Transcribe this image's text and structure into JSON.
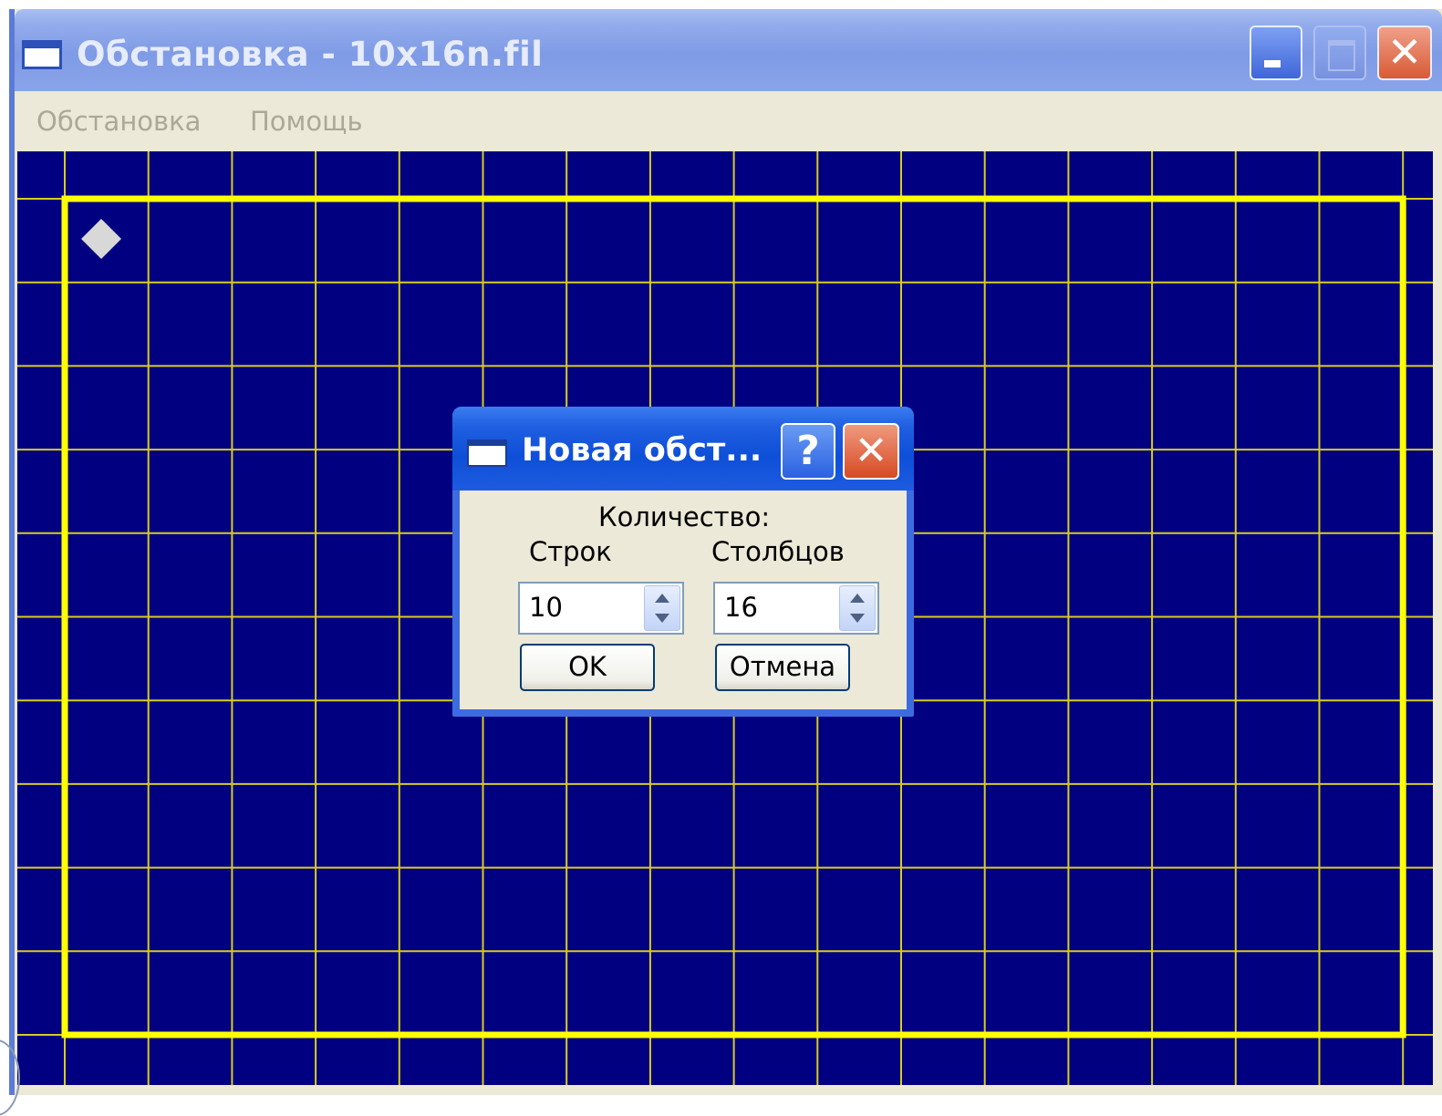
{
  "window": {
    "title": "Обстановка - 10x16n.fil",
    "icon": "window-app-icon",
    "buttons": {
      "minimize": "minimize-icon",
      "maximize": "maximize-icon",
      "close": "✕"
    }
  },
  "menu": {
    "items": [
      {
        "label": "Обстановка"
      },
      {
        "label": "Помощь"
      }
    ]
  },
  "field": {
    "rows": 10,
    "cols": 16,
    "background_color": "#000080",
    "grid_color": "#d8cc20",
    "border_color": "#ffff00",
    "robot": {
      "row": 1,
      "col": 1,
      "icon": "robot-diamond-icon",
      "color": "#d8d8d8"
    }
  },
  "dialog": {
    "title": "Новая обст...",
    "help_label": "?",
    "close_label": "✕",
    "quantity_label": "Количество:",
    "rows_label": "Строк",
    "cols_label": "Столбцов",
    "rows_value": "10",
    "cols_value": "16",
    "ok_label": "OK",
    "cancel_label": "Отмена"
  }
}
